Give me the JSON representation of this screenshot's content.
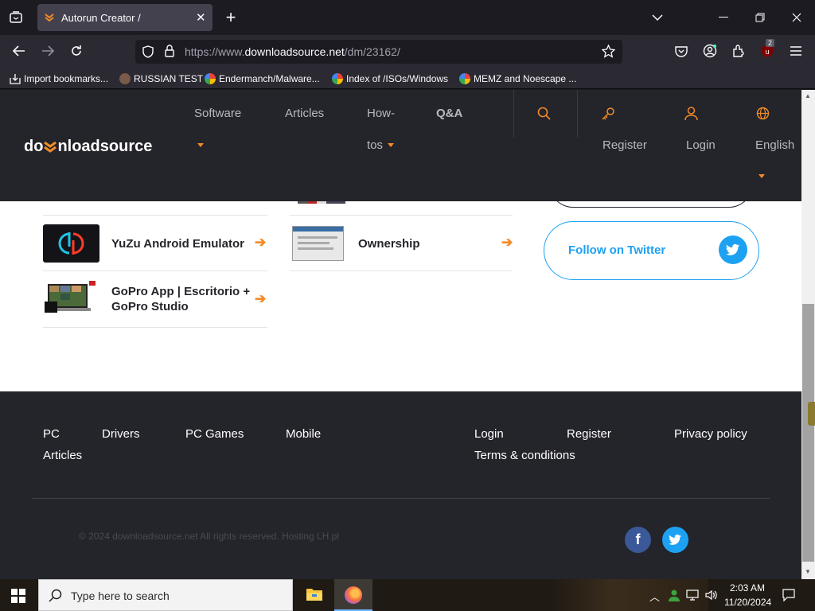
{
  "browser": {
    "tab_title": "Autorun Creator /",
    "url_prefix": "https://www.",
    "url_domain": "downloadsource.net",
    "url_path": "/dm/23162/",
    "extension_badge": "2",
    "bookmarks": [
      {
        "label": "Import bookmarks...",
        "icon": "import-icon"
      },
      {
        "label": "RUSSIAN TEST",
        "icon": "face-icon"
      },
      {
        "label": "Endermanch/Malware...",
        "icon": "google-icon"
      },
      {
        "label": "Index of /ISOs/Windows",
        "icon": "google-icon"
      },
      {
        "label": "MEMZ and Noescape ...",
        "icon": "google-icon"
      }
    ]
  },
  "site": {
    "logo": {
      "part1": "do",
      "part2": "nloadsource"
    },
    "nav": {
      "software": "Software",
      "articles": "Articles",
      "howtos_line1": "How-",
      "howtos_line2": "tos",
      "qa": "Q&A",
      "register": "Register",
      "login": "Login",
      "language": "English"
    },
    "related": [
      {
        "title": "YuZu Android Emulator"
      },
      {
        "title_line1": "GoPro App | Escritorio +",
        "title_line2": "GoPro Studio"
      },
      {
        "title": "Ownership"
      }
    ],
    "follow_twitter": "Follow on Twitter",
    "footer": {
      "links_left": [
        "PC",
        "Drivers",
        "PC Games",
        "Mobile",
        "Articles"
      ],
      "links_right": [
        "Login",
        "Register",
        "Privacy policy",
        "Terms & conditions"
      ],
      "copyright": "© 2024 downloadsource.net All rights reserved. Hosting LH.pl"
    }
  },
  "taskbar": {
    "search_placeholder": "Type here to search",
    "time": "2:03 AM",
    "date": "11/20/2024"
  },
  "colors": {
    "accent": "#f28b27",
    "twitter": "#1da1f2",
    "facebook": "#3b5998",
    "header_bg": "#24242b"
  }
}
